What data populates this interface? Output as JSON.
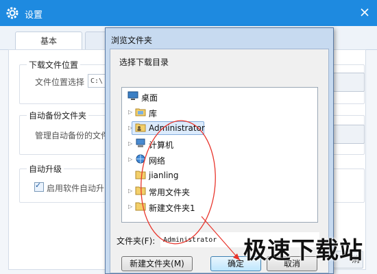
{
  "settings": {
    "title": "设置",
    "tabs": [
      "基本",
      ""
    ],
    "download_group": {
      "title": "下载文件位置",
      "label": "文件位置选择",
      "path": "C:\\"
    },
    "backup_group": {
      "title": "自动备份文件夹",
      "label": "管理自动备份的文件"
    },
    "upgrade_group": {
      "title": "自动升级",
      "checkbox_label": "启用软件自动升",
      "checked": true
    },
    "bottom_right_button": "消"
  },
  "dialog": {
    "title": "浏览文件夹",
    "prompt": "选择下载目录",
    "tree": [
      {
        "label": "桌面",
        "icon": "desktop-icon",
        "expandable": false
      },
      {
        "label": "库",
        "icon": "library-icon",
        "expandable": true
      },
      {
        "label": "Administrator",
        "icon": "user-folder-icon",
        "expandable": true,
        "selected": true
      },
      {
        "label": "计算机",
        "icon": "computer-icon",
        "expandable": true
      },
      {
        "label": "网络",
        "icon": "network-icon",
        "expandable": true
      },
      {
        "label": "jianling",
        "icon": "folder-icon",
        "expandable": false
      },
      {
        "label": "常用文件夹",
        "icon": "folder-icon",
        "expandable": true
      },
      {
        "label": "新建文件夹1",
        "icon": "folder-icon",
        "expandable": true
      }
    ],
    "folder_label": "文件夹(F):",
    "folder_value": "Administrator",
    "new_folder_button": "新建文件夹(M)",
    "ok_button": "确定",
    "cancel_button": "取消"
  },
  "watermark": "极速下载站",
  "colors": {
    "titlebar": "#1e8ae0",
    "annotation": "#e8332a",
    "selection": "#dcebfc"
  }
}
